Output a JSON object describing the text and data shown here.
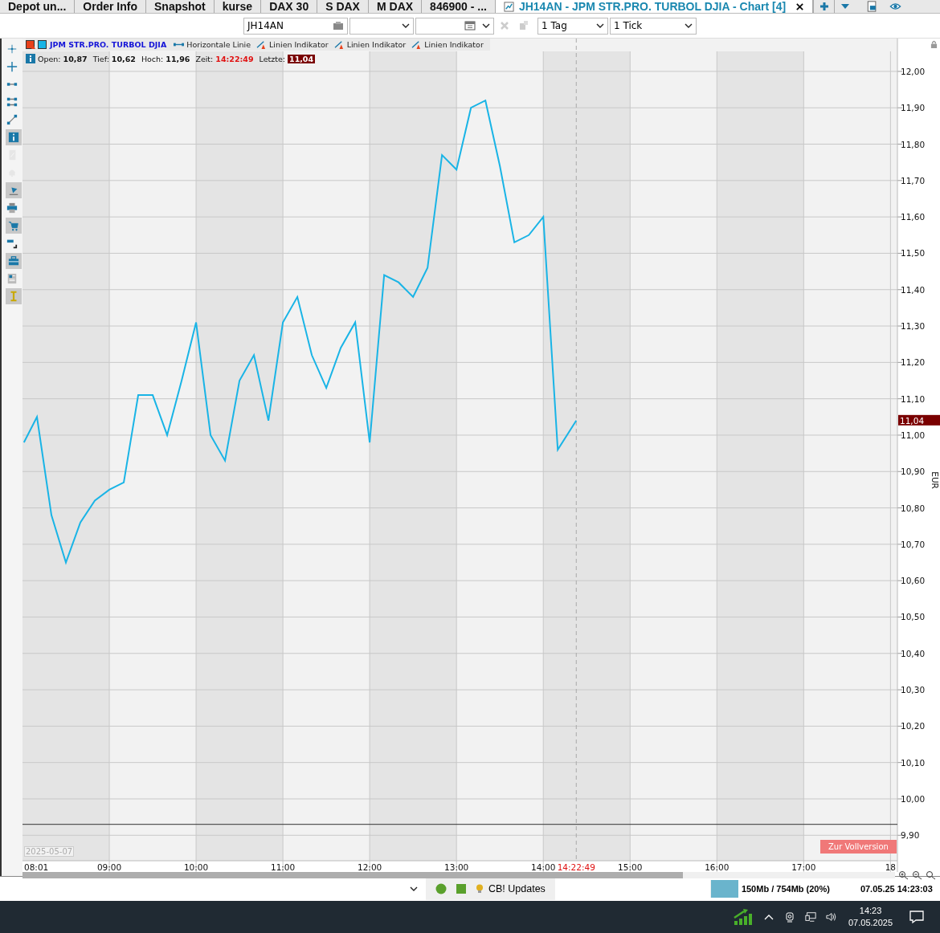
{
  "tabs": [
    {
      "label": "Depot un...",
      "selected": false
    },
    {
      "label": "Order Info",
      "selected": false
    },
    {
      "label": "Snapshot",
      "selected": false
    },
    {
      "label": "kurse",
      "selected": false
    },
    {
      "label": "DAX 30",
      "selected": false
    },
    {
      "label": "S DAX",
      "selected": false
    },
    {
      "label": "M DAX",
      "selected": false
    },
    {
      "label": "846900 - ...",
      "selected": false
    },
    {
      "label": "JH14AN - JPM STR.PRO. TURBOL DJIA - Chart [4]",
      "selected": true
    }
  ],
  "toolbar": {
    "symbol": "JH14AN",
    "period": "1 Tag",
    "interval": "1 Tick"
  },
  "left_toolbar": [
    {
      "kind": "crosshair",
      "selected": false,
      "disabled": false
    },
    {
      "kind": "cross",
      "selected": false,
      "disabled": false
    },
    {
      "kind": "hline",
      "selected": false,
      "disabled": false
    },
    {
      "kind": "hlines",
      "selected": false,
      "disabled": false
    },
    {
      "kind": "trendline",
      "selected": false,
      "disabled": false
    },
    {
      "kind": "info",
      "selected": true,
      "disabled": false
    },
    {
      "kind": "percent",
      "selected": false,
      "disabled": true
    },
    {
      "kind": "bell",
      "selected": false,
      "disabled": true
    },
    {
      "kind": "marker",
      "selected": true,
      "disabled": false
    },
    {
      "kind": "printer",
      "selected": false,
      "disabled": false
    },
    {
      "kind": "cart",
      "selected": true,
      "disabled": false
    },
    {
      "kind": "corner",
      "selected": false,
      "disabled": false
    },
    {
      "kind": "briefcase",
      "selected": true,
      "disabled": false
    },
    {
      "kind": "news",
      "selected": false,
      "disabled": false
    },
    {
      "kind": "tool",
      "selected": true,
      "disabled": false
    }
  ],
  "legend": {
    "indicators": [
      {
        "kind": "hline",
        "label": "Horizontale Linie"
      },
      {
        "kind": "line",
        "label": "Linien Indikator"
      },
      {
        "kind": "line",
        "label": "Linien Indikator"
      },
      {
        "kind": "line",
        "label": "Linien Indikator"
      }
    ]
  },
  "info": [
    {
      "kind": "plain",
      "label": "Open:",
      "value": "10,87"
    },
    {
      "kind": "plain",
      "label": "Tief:",
      "value": "10,62"
    },
    {
      "kind": "plain",
      "label": "Hoch:",
      "value": "11,96"
    },
    {
      "kind": "time",
      "label": "Zeit:",
      "value": "14:22:49"
    },
    {
      "kind": "last",
      "label": "Letzte:",
      "value": "11,04"
    }
  ],
  "chart_data": {
    "type": "line",
    "ylabel": "EUR",
    "ylim": [
      9.83,
      12.055
    ],
    "xlim": [
      8,
      18.08
    ],
    "grid": true,
    "x": [
      8.0167,
      8.1667,
      8.3333,
      8.5,
      8.6667,
      8.8333,
      9,
      9.1667,
      9.3333,
      9.5,
      9.6667,
      9.8333,
      10,
      10.1667,
      10.3333,
      10.5,
      10.6667,
      10.8333,
      11,
      11.1667,
      11.3333,
      11.5,
      11.6667,
      11.8333,
      12,
      12.1667,
      12.3333,
      12.5,
      12.6667,
      12.8333,
      13,
      13.1667,
      13.3333,
      13.5,
      13.6667,
      13.8333,
      14,
      14.1667,
      14.38
    ],
    "series": [
      {
        "name": "JPM STR.PRO. TURBOL DJIA",
        "color": "#19b4e6",
        "values": [
          10.98,
          11.05,
          10.78,
          10.65,
          10.76,
          10.82,
          10.85,
          10.87,
          11.11,
          11.11,
          11.0,
          11.15,
          11.31,
          11.0,
          10.93,
          11.15,
          11.22,
          11.04,
          11.31,
          11.38,
          11.22,
          11.13,
          11.24,
          11.31,
          10.98,
          11.44,
          11.42,
          11.38,
          11.46,
          11.77,
          11.73,
          11.9,
          11.92,
          11.74,
          11.53,
          11.55,
          11.6,
          10.96,
          11.04
        ]
      }
    ],
    "yticks": [
      {
        "value": 12.0,
        "label": "12,00"
      },
      {
        "value": 11.9,
        "label": "11,90"
      },
      {
        "value": 11.8,
        "label": "11,80"
      },
      {
        "value": 11.7,
        "label": "11,70"
      },
      {
        "value": 11.6,
        "label": "11,60"
      },
      {
        "value": 11.5,
        "label": "11,50"
      },
      {
        "value": 11.4,
        "label": "11,40"
      },
      {
        "value": 11.3,
        "label": "11,30"
      },
      {
        "value": 11.2,
        "label": "11,20"
      },
      {
        "value": 11.1,
        "label": "11,10"
      },
      {
        "value": 11.0,
        "label": "11,00"
      },
      {
        "value": 10.9,
        "label": "10,90"
      },
      {
        "value": 10.8,
        "label": "10,80"
      },
      {
        "value": 10.7,
        "label": "10,70"
      },
      {
        "value": 10.6,
        "label": "10,60"
      },
      {
        "value": 10.5,
        "label": "10,50"
      },
      {
        "value": 10.4,
        "label": "10,40"
      },
      {
        "value": 10.3,
        "label": "10,30"
      },
      {
        "value": 10.2,
        "label": "10,20"
      },
      {
        "value": 10.1,
        "label": "10,10"
      },
      {
        "value": 10.0,
        "label": "10,00"
      },
      {
        "value": 9.9,
        "label": "9,90"
      }
    ],
    "xticks": [
      {
        "value": 9,
        "label": "09:00"
      },
      {
        "value": 10,
        "label": "10:00"
      },
      {
        "value": 11,
        "label": "11:00"
      },
      {
        "value": 12,
        "label": "12:00"
      },
      {
        "value": 13,
        "label": "13:00"
      },
      {
        "value": 14,
        "label": "14:00"
      },
      {
        "value": 15,
        "label": "15:00"
      },
      {
        "value": 16,
        "label": "16:00"
      },
      {
        "value": 17,
        "label": "17:00"
      },
      {
        "value": 18,
        "label": "18"
      }
    ],
    "ref_lines": [
      {
        "axis": "y",
        "value": 9.93
      },
      {
        "axis": "x",
        "value": 14.38,
        "label": "14:22:49"
      }
    ],
    "bands": [
      {
        "axis": "x",
        "from": 8,
        "to": 9
      },
      {
        "axis": "x",
        "from": 10,
        "to": 11
      },
      {
        "axis": "x",
        "from": 12,
        "to": 13
      },
      {
        "axis": "x",
        "from": 14,
        "to": 15
      },
      {
        "axis": "x",
        "from": 16,
        "to": 17
      }
    ]
  },
  "last_price_tag": "11,04",
  "start_time_label": "08:01",
  "date_stamp": "2025-05-07",
  "upgrade_button": "Zur Vollversion",
  "status_bar": {
    "updates": "CB! Updates",
    "memory": {
      "text": "150Mb / 754Mb (20%)",
      "level": 0.2
    },
    "datetime": "07.05.25 14:23:03"
  },
  "taskbar": {
    "time": "14:23",
    "date": "07.05.2025"
  }
}
